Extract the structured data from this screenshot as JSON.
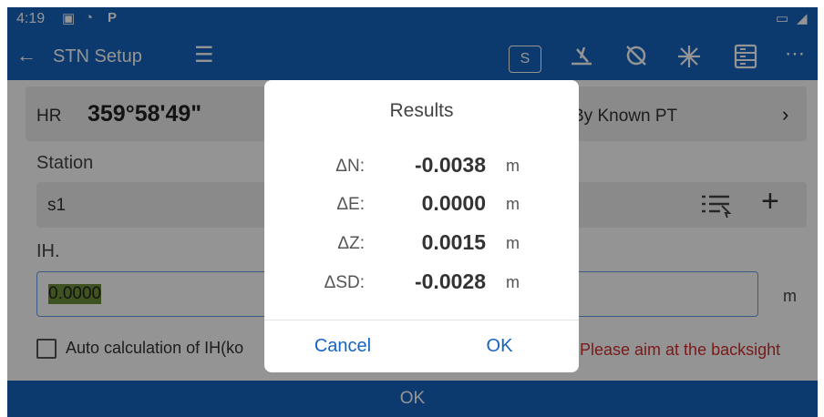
{
  "status_bar": {
    "time": "4:19",
    "carrier_icon": "P"
  },
  "app_bar": {
    "back_icon": "←",
    "title": "STN Setup",
    "menu_icon": "☰",
    "s_button": "S",
    "more_icon": "⋯"
  },
  "hr": {
    "label": "HR",
    "value": "359°58'49\""
  },
  "method": {
    "label": "By Known PT",
    "chevron": "›"
  },
  "station": {
    "label": "Station",
    "value": "s1",
    "plus": "+"
  },
  "ih": {
    "label": "IH.",
    "value": "0.0000",
    "unit": "m"
  },
  "auto_calc": {
    "label": "Auto calculation of IH(ko",
    "checked": false
  },
  "aim_message": "Please aim at the backsight",
  "bottom_button": "OK",
  "dialog": {
    "title": "Results",
    "rows": [
      {
        "label": "ΔN:",
        "value": "-0.0038",
        "unit": "m"
      },
      {
        "label": "ΔE:",
        "value": "0.0000",
        "unit": "m"
      },
      {
        "label": "ΔZ:",
        "value": "0.0015",
        "unit": "m"
      },
      {
        "label": "ΔSD:",
        "value": "-0.0028",
        "unit": "m"
      }
    ],
    "cancel": "Cancel",
    "ok": "OK"
  },
  "colors": {
    "primary": "#1565c0",
    "error": "#d32f2f",
    "highlight": "#6d8f3a"
  }
}
